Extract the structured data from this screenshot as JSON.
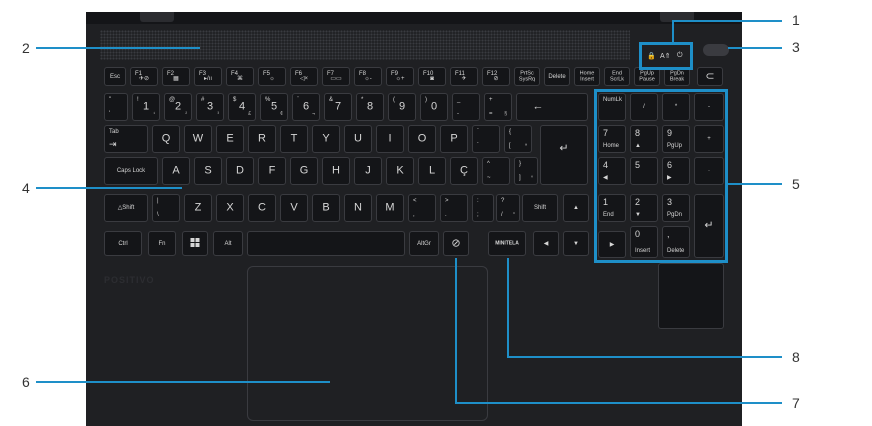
{
  "brand_logo": "POSITIVO",
  "indicator_icons": [
    "lock-icon",
    "caps-lock-light-icon",
    "power-light-icon"
  ],
  "indicator_glyphs": [
    "🔒",
    "A⇑",
    "⏻"
  ],
  "callout_color": "#1e8fc8",
  "callouts": {
    "c1": "1",
    "c2": "2",
    "c3": "3",
    "c4": "4",
    "c5": "5",
    "c6": "6",
    "c7": "7",
    "c8": "8"
  },
  "keys": {
    "esc": "Esc",
    "f1": "F1",
    "f1_icon": "✈⊘",
    "f2": "F2",
    "f2_icon": "▦",
    "f3": "F3",
    "f3_icon": "▸/ıı",
    "f4": "F4",
    "f4_icon": "⌘",
    "f5": "F5",
    "f5_icon": "☼",
    "f6": "F6",
    "f6_icon": "◁×",
    "f7": "F7",
    "f7_icon": "▭▭",
    "f8": "F8",
    "f8_icon": "☼-",
    "f9": "F9",
    "f9_icon": "☼+",
    "f10": "F10",
    "f10_icon": "◙",
    "f11": "F11",
    "f11_icon": "✈",
    "f12": "F12",
    "f12_icon": "⊘",
    "prtsc": "PrtSc",
    "sysrq": "SysRq",
    "delete": "Delete",
    "home": "Home",
    "insert": "Insert",
    "end": "End",
    "scrlk": "ScrLk",
    "pgup": "PgUp",
    "pause": "Pause",
    "pgdn": "PgDn",
    "break": "Break",
    "copilot_icon": "⊂",
    "quote_top": "\"",
    "quote_bottom": "'",
    "n1": "1",
    "n1_top": "!",
    "n1_alt": "¹",
    "n2": "2",
    "n2_top": "@",
    "n2_alt": "²",
    "n3": "3",
    "n3_top": "#",
    "n3_alt": "³",
    "n4": "4",
    "n4_top": "$",
    "n4_alt": "£",
    "n5": "5",
    "n5_top": "%",
    "n5_alt": "¢",
    "n6": "6",
    "n6_top": "¨",
    "n6_alt": "¬",
    "n7": "7",
    "n7_top": "&",
    "n8": "8",
    "n8_top": "*",
    "n9": "9",
    "n9_top": "(",
    "n0": "0",
    "n0_top": ")",
    "minus": "-",
    "minus_top": "_",
    "equal": "=",
    "equal_top": "+",
    "equal_alt": "§",
    "backspace": "←",
    "tab": "Tab",
    "tab_icon": "⇥",
    "q": "Q",
    "w": "W",
    "e": "E",
    "r": "R",
    "t": "T",
    "y": "Y",
    "u": "U",
    "i": "I",
    "o": "O",
    "p": "P",
    "acute_top": "`",
    "acute": "´",
    "bracket_top": "{",
    "bracket": "[",
    "bracket_alt": "ª",
    "enter": "↵",
    "capslock": "Caps Lock",
    "a": "A",
    "s": "S",
    "d": "D",
    "f": "F",
    "g": "G",
    "h": "H",
    "j": "J",
    "k": "K",
    "l": "L",
    "c_cedilla": "Ç",
    "tilde_top": "^",
    "tilde": "~",
    "rbracket_top": "}",
    "rbracket": "]",
    "rbracket_alt": "º",
    "shift_left": "△Shift",
    "backslash_top": "|",
    "backslash": "\\",
    "z": "Z",
    "x": "X",
    "c": "C",
    "v": "V",
    "b": "B",
    "n": "N",
    "m": "M",
    "comma_top": "<",
    "comma": ",",
    "period_top": ">",
    "period": ".",
    "semicolon_top": ":",
    "semicolon": ";",
    "slash_top": "?",
    "slash": "/",
    "slash_alt": "°",
    "shift_right": "Shift",
    "up": "▲",
    "down": "▼",
    "left": "◀",
    "right": "▶",
    "ctrl": "Ctrl",
    "fn": "Fn",
    "alt": "Alt",
    "altgr": "AltGr",
    "ai_icon": "⊘",
    "minitela": "MINITELA",
    "numlk": "NumLk",
    "np_slash": "/",
    "np_star": "*",
    "np_minus": "-",
    "np_plus": "+",
    "np_dot": "·",
    "np7": "7",
    "np7_sub": "Home",
    "np8": "8",
    "np8_sub": "▲",
    "np9": "9",
    "np9_sub": "PgUp",
    "np4": "4",
    "np4_sub": "◀",
    "np5": "5",
    "np6": "6",
    "np6_sub": "▶",
    "np1": "1",
    "np1_sub": "End",
    "np2": "2",
    "np2_sub": "▼",
    "np3": "3",
    "np3_sub": "PgDn",
    "np0": "0",
    "np0_sub": "Insert",
    "npdec": ",",
    "npdec_sub": "Delete",
    "np_enter": "↵"
  }
}
